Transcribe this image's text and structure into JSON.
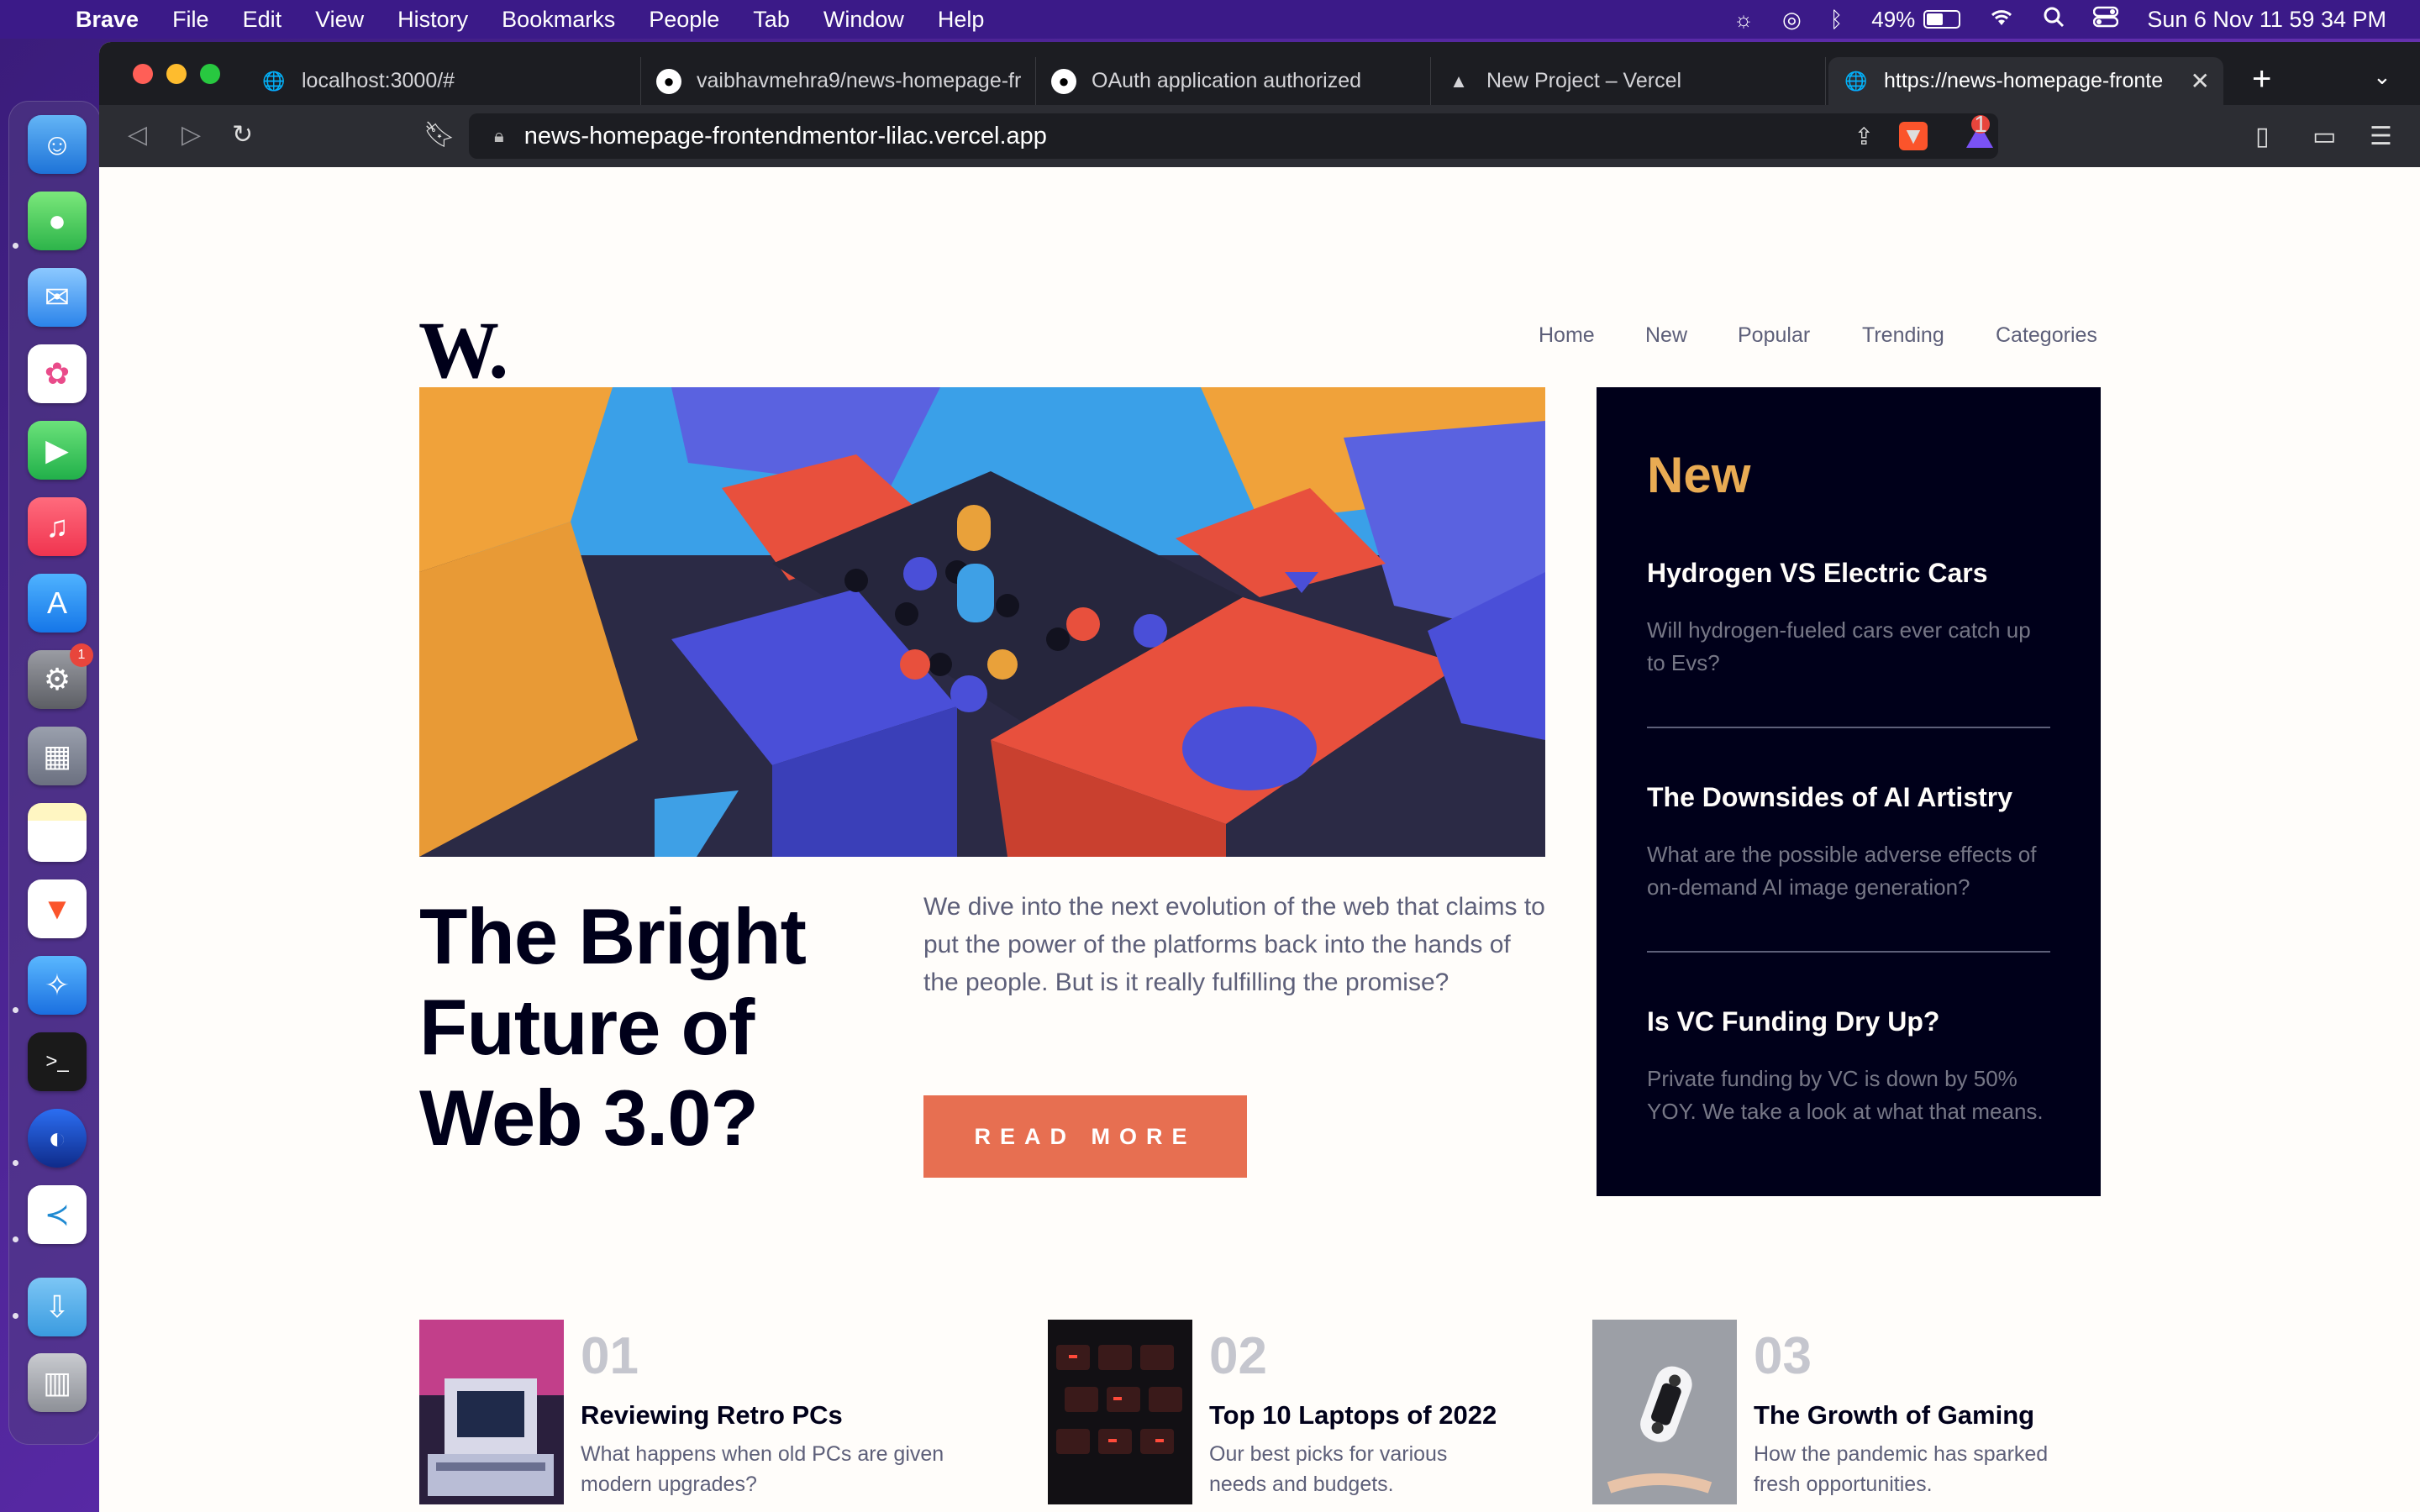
{
  "menubar": {
    "app": "Brave",
    "items": [
      "File",
      "Edit",
      "View",
      "History",
      "Bookmarks",
      "People",
      "Tab",
      "Window",
      "Help"
    ],
    "battery": "49%",
    "battery_level": 0.49,
    "clock": "Sun 6 Nov  11 59 34 PM"
  },
  "dock": {
    "apps": [
      "finder-icon",
      "messages-icon",
      "mail-icon",
      "photos-icon",
      "facetime-icon",
      "music-icon",
      "app-store-icon",
      "system-preferences-icon",
      "launchpad-icon",
      "notes-icon",
      "brave-icon",
      "safari-icon",
      "terminal-icon",
      "firefox-icon",
      "vscode-icon",
      "downloads-icon",
      "trash-icon"
    ],
    "settings_badge": "1"
  },
  "browser": {
    "tabs": [
      {
        "title": "localhost:3000/#",
        "icon": "globe-icon"
      },
      {
        "title": "vaibhavmehra9/news-homepage-fr",
        "icon": "github-icon"
      },
      {
        "title": "OAuth application authorized",
        "icon": "github-icon"
      },
      {
        "title": "New Project – Vercel",
        "icon": "vercel-icon"
      },
      {
        "title": "https://news-homepage-fronte",
        "icon": "globe-icon"
      }
    ],
    "url": "news-homepage-frontendmentor-lilac.vercel.app",
    "rewards_badge": "1"
  },
  "site": {
    "logo": "W.",
    "nav": [
      "Home",
      "New",
      "Popular",
      "Trending",
      "Categories"
    ],
    "hero": {
      "title": "The Bright Future of Web 3.0?",
      "description": "We dive into the next evolution of the web that claims to put the power of the platforms back into the hands of the people. But is it really fulfilling the promise?",
      "button": "READ MORE"
    },
    "new_section": {
      "heading": "New",
      "items": [
        {
          "title": "Hydrogen VS Electric Cars",
          "text": "Will hydrogen-fueled cars ever catch up to Evs?"
        },
        {
          "title": "The Downsides of AI Artistry",
          "text": "What are the possible adverse effects of on-demand AI image generation?"
        },
        {
          "title": "Is VC Funding Dry Up?",
          "text": "Private funding by VC is down by 50% YOY. We take a look at what that means."
        }
      ]
    },
    "bottom": [
      {
        "num": "01",
        "title": "Reviewing Retro PCs",
        "text": "What happens when old PCs are given modern upgrades?"
      },
      {
        "num": "02",
        "title": "Top 10 Laptops of 2022",
        "text": "Our best picks for various needs and budgets."
      },
      {
        "num": "03",
        "title": "The Growth of Gaming",
        "text": "How the pandemic has sparked fresh opportunities."
      }
    ]
  },
  "colors": {
    "accent": "#e76f51",
    "gold": "#e9ab53",
    "navy": "#00001a",
    "gray": "#5d5f79"
  }
}
